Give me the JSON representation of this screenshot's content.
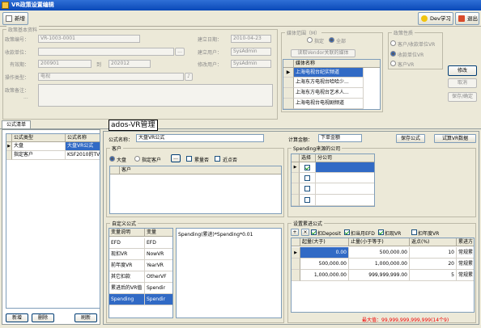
{
  "window": {
    "title": "VR政策设置编辑"
  },
  "toolbar": {
    "new_label": "新增",
    "study_label": "Dev学习",
    "exit_label": "退出"
  },
  "basic": {
    "legend": "政策基本资料",
    "policy_no_label": "政策编号：",
    "policy_no_value": "VR-1003-0001",
    "build_date_label": "建立日期：",
    "build_date_value": "2010-04-23",
    "vendor_label": "收款单位：",
    "build_user_label": "建立用户：",
    "build_user_value": "SysAdmin",
    "period_label": "有效期：",
    "period_from": "200901",
    "period_to_label": "到",
    "period_to": "202012",
    "modify_user_label": "修改用户：",
    "modify_user_value": "SysAdmin",
    "type_label": "操作类型：",
    "type_value": "电视",
    "remark_label": "政策备注：",
    "dots": "...",
    "vendor_btn": "...",
    "type_btn": "♪"
  },
  "media": {
    "legend": "媒体范围（M）",
    "opt_specified": "指定",
    "opt_all": "全部",
    "fetch_btn": "读取Vendor关联的媒体",
    "col_header": "媒体名称",
    "items": [
      "上海电视台纪实频道",
      "上海东方电视台哈哈少...",
      "上海东方电视台艺术人...",
      "上海电视台电视剧频道"
    ]
  },
  "nature": {
    "legend": "政策性质",
    "opt1": "客户/收款单位VR",
    "opt2": "收款单位VR",
    "opt3": "客户VR"
  },
  "side_buttons": {
    "modify": "修改",
    "cancel": "取消",
    "save": "保存/确定"
  },
  "left_tab": {
    "tab": "公式清单",
    "col_type": "公式类型",
    "col_name": "公式名称",
    "rows": [
      {
        "type": "大盘",
        "name": "大盘VR公式"
      },
      {
        "type": "指定客户",
        "name": "KSF2010的TV-"
      }
    ],
    "btn_new": "新增",
    "btn_delete": "删除",
    "btn_refresh": "刷新"
  },
  "tooltip": "ados-VR管理",
  "formula": {
    "name_label": "公式名称：",
    "name_value": "大盘VR公式",
    "calc_label": "计算金额：",
    "calc_value": "下单金额",
    "save_btn": "保存公式",
    "try_btn": "试算VR数据",
    "client_legend": "客户",
    "opt_big": "大盘",
    "opt_client": "指定客户",
    "accum_label": "累量否",
    "near_label": "近点否",
    "client_col": "客户",
    "spending_legend": "Spending来源的公司",
    "sp_col_select": "选择",
    "sp_col_company": "分公司",
    "custom_legend": "自定义公式",
    "var_col_desc": "变量说明",
    "var_col_var": "变量",
    "vars": [
      {
        "desc": "EFD",
        "var": "EFD"
      },
      {
        "desc": "现扣VR",
        "var": "NowVR"
      },
      {
        "desc": "前年度VR",
        "var": "YearVR"
      },
      {
        "desc": "其它扣款",
        "var": "OtherVF"
      },
      {
        "desc": "累进后的VR值",
        "var": "Spendir"
      },
      {
        "desc": "Spending",
        "var": "Spendir"
      }
    ],
    "expr": "Spending(累进)*Spending*0.01",
    "progress_legend": "设置累进公式",
    "chk_deposit": "扣Deposit",
    "chk_efd": "扣当月EFD",
    "chk_now_vr": "扣现VR",
    "chk_year_vr": "扣年度VR",
    "prog_cols": [
      "起量(大于)",
      "止量(小于等于)",
      "返点(%)",
      "累进方"
    ],
    "prog_rows": [
      [
        "0.00",
        "500,000.00",
        "10",
        "常规累"
      ],
      [
        "500,000.00",
        "1,000,000.00",
        "20",
        "常规累"
      ],
      [
        "1,000,000.00",
        "999,999,999.00",
        "5",
        "常规累"
      ]
    ],
    "max_text": "最大值：99,999,999,999,999(14个9)"
  },
  "colors": {
    "accent": "#316ac5",
    "title_bar": "#0a48b8",
    "warning": "#ee0000"
  }
}
